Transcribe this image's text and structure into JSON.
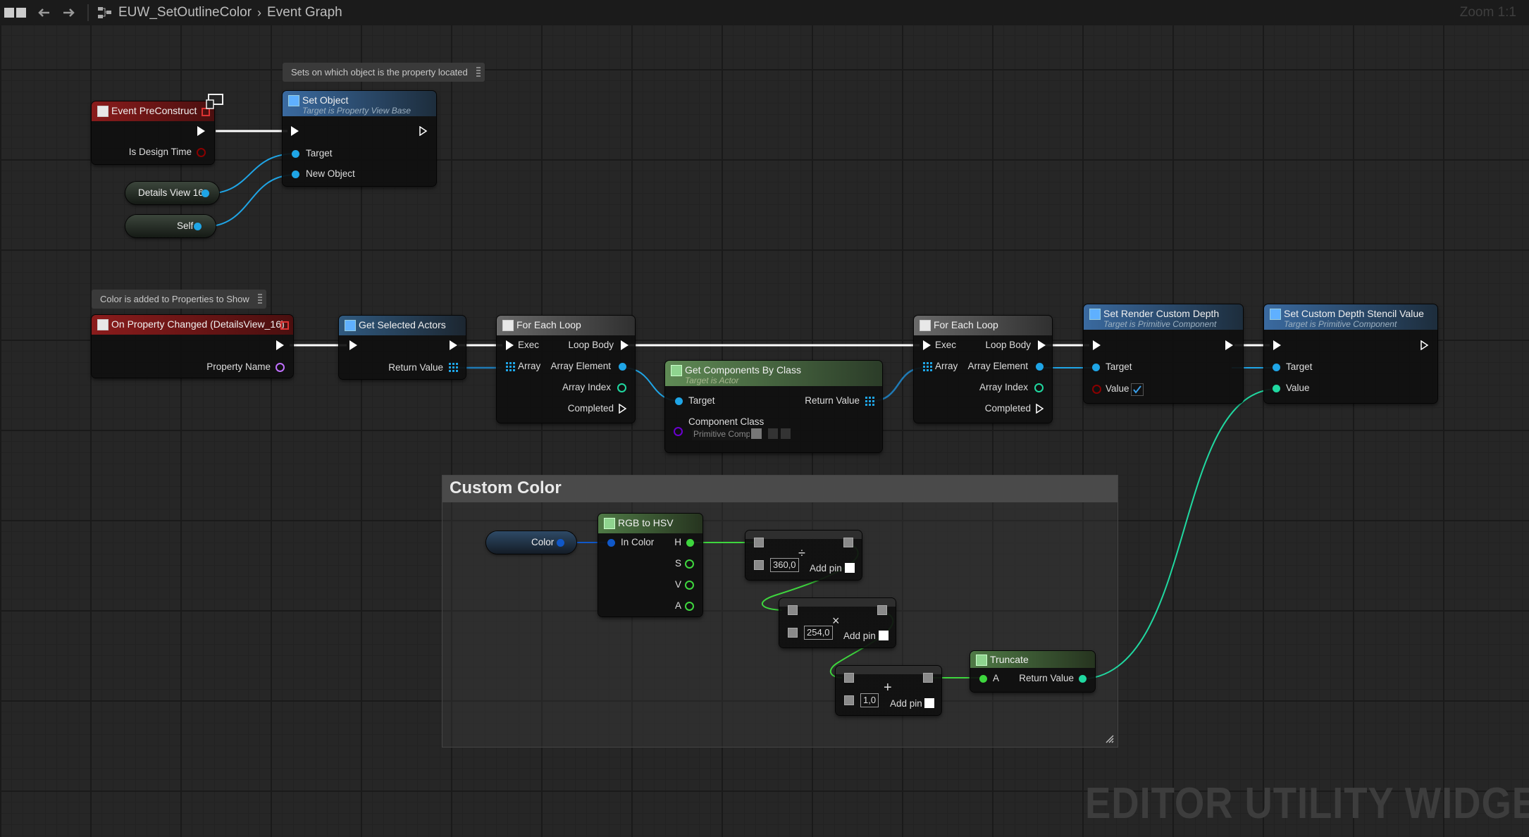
{
  "toolbar": {
    "asset_name": "EUW_SetOutlineColor",
    "graph_name": "Event Graph",
    "zoom": "Zoom 1:1"
  },
  "watermark": "EDITOR UTILITY WIDGET",
  "comments": {
    "set_object": "Sets on which object is the property located",
    "color_added": "Color is added to Properties to Show"
  },
  "frame": {
    "title": "Custom Color"
  },
  "nodes": {
    "event_preconstruct": {
      "title": "Event PreConstruct",
      "pin_design_time": "Is Design Time"
    },
    "set_object": {
      "title": "Set Object",
      "subtitle": "Target is Property View Base",
      "pin_target": "Target",
      "pin_new_object": "New Object"
    },
    "details_view": {
      "label": "Details View 16"
    },
    "self": {
      "label": "Self"
    },
    "on_property_changed": {
      "title": "On Property Changed (DetailsView_16)",
      "pin_property_name": "Property Name"
    },
    "get_selected_actors": {
      "title": "Get Selected Actors",
      "pin_return": "Return Value"
    },
    "for_each_1": {
      "title": "For Each Loop",
      "pin_exec": "Exec",
      "pin_loop_body": "Loop Body",
      "pin_array": "Array",
      "pin_array_element": "Array Element",
      "pin_array_index": "Array Index",
      "pin_completed": "Completed"
    },
    "get_components": {
      "title": "Get Components By Class",
      "subtitle": "Target is Actor",
      "pin_target": "Target",
      "pin_return": "Return Value",
      "pin_component_class": "Component Class",
      "class_value": "Primitive Comp"
    },
    "for_each_2": {
      "title": "For Each Loop",
      "pin_exec": "Exec",
      "pin_loop_body": "Loop Body",
      "pin_array": "Array",
      "pin_array_element": "Array Element",
      "pin_array_index": "Array Index",
      "pin_completed": "Completed"
    },
    "set_render_depth": {
      "title": "Set Render Custom Depth",
      "subtitle": "Target is Primitive Component",
      "pin_target": "Target",
      "pin_value": "Value"
    },
    "set_stencil": {
      "title": "Set Custom Depth Stencil Value",
      "subtitle": "Target is Primitive Component",
      "pin_target": "Target",
      "pin_value": "Value"
    },
    "color_var": {
      "label": "Color"
    },
    "rgb_to_hsv": {
      "title": "RGB to HSV",
      "pin_in": "In Color",
      "pin_h": "H",
      "pin_s": "S",
      "pin_v": "V",
      "pin_a": "A"
    },
    "divide": {
      "symbol": "÷",
      "value": "360,0",
      "add_pin": "Add pin"
    },
    "multiply": {
      "symbol": "×",
      "value": "254,0",
      "add_pin": "Add pin"
    },
    "add": {
      "symbol": "+",
      "value": "1,0",
      "add_pin": "Add pin"
    },
    "truncate": {
      "title": "Truncate",
      "pin_a": "A",
      "pin_return": "Return Value"
    }
  },
  "colors": {
    "exec": "#ffffff",
    "object_pin": "#1fa5e6",
    "float_pin": "#3ed63e",
    "int_pin": "#20d8a0",
    "bool_pin": "#8a0000",
    "name_pin": "#c070ff",
    "class_pin": "#6a00d0",
    "struct_pin": "#1058c8"
  }
}
